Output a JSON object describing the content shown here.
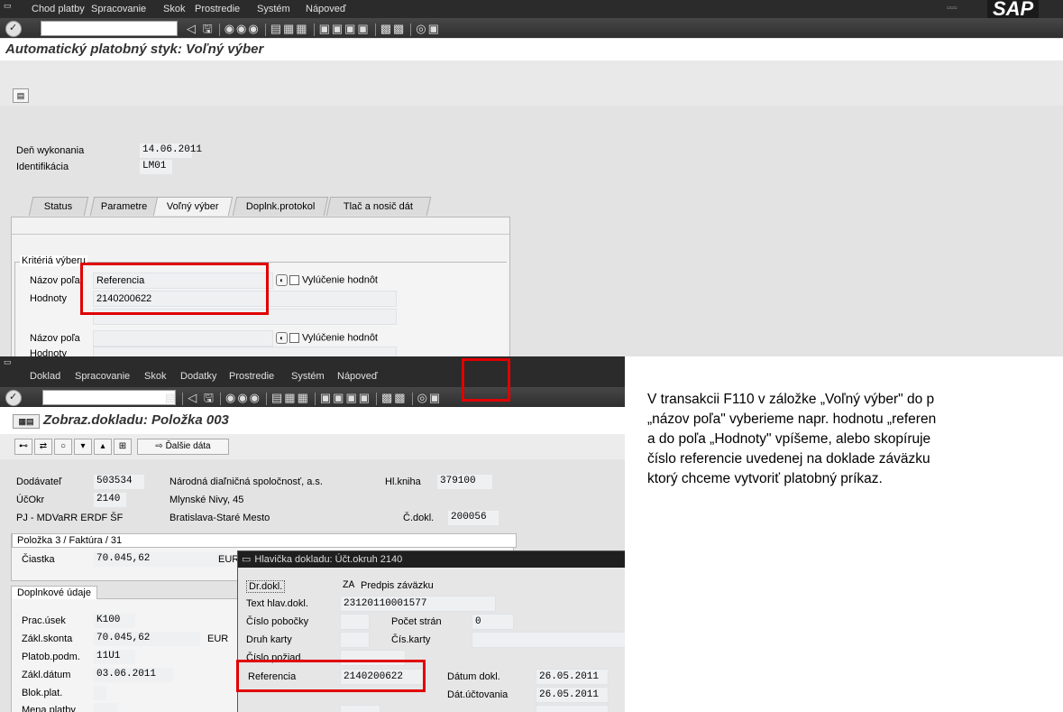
{
  "screen1": {
    "menu": [
      "Chod platby",
      "Spracovanie",
      "Skok",
      "Prostredie",
      "Systém",
      "Nápoveď"
    ],
    "logo": "SAP",
    "title": "Automatický platobný styk: Voľný výber",
    "fields": {
      "execution_day_label": "Deň wykonania",
      "execution_day_value": "14.06.2011",
      "identification_label": "Identifikácia",
      "identification_value": "LM01"
    },
    "tabs": [
      "Status",
      "Parametre",
      "Voľný výber",
      "Doplnk.protokol",
      "Tlač a nosič dát"
    ],
    "active_tab": "Voľný výber",
    "criteria": {
      "title": "Kritériá výberu",
      "field_name_label": "Názov poľa",
      "field_name_value": "Referencia",
      "values_label": "Hodnoty",
      "values_value": "2140200622",
      "exclude_label": "Vylúčenie hodnôt",
      "field_name_label2": "Názov poľa",
      "exclude_label2": "Vylúčenie hodnôt",
      "values_label2": "Hodnoty"
    }
  },
  "screen2": {
    "menu": [
      "Doklad",
      "Spracovanie",
      "Skok",
      "Dodatky",
      "Prostredie",
      "Systém",
      "Nápoveď"
    ],
    "title": "Zobraz.dokladu: Položka 003",
    "more_data_button": "Ďalšie dáta",
    "header": {
      "vendor_label": "Dodávateľ",
      "vendor_value": "503534",
      "vendor_name": "Národná diaľničná spoločnosť, a.s.",
      "ledger_label": "Hl.kniha",
      "ledger_value": "379100",
      "company_code_label": "ÚčOkr",
      "company_code_value": "2140",
      "street": "Mlynské Nivy, 45",
      "project": "PJ - MDVaRR ERDF ŠF",
      "city": "Bratislava-Staré Mesto",
      "doc_no_label": "Č.dokl.",
      "doc_no_value": "200056"
    },
    "item_group": "Položka 3 / Faktúra / 31",
    "amount_label": "Čiastka",
    "amount_value": "70.045,62",
    "currency": "EUR",
    "additional": {
      "title": "Doplnkové údaje",
      "work_unit_label": "Prac.úsek",
      "work_unit_value": "K100",
      "discount_base_label": "Zákl.skonta",
      "discount_base_value": "70.045,62",
      "currency": "EUR",
      "payment_terms_label": "Platob.podm.",
      "payment_terms_value": "11U1",
      "base_date_label": "Zákl.dátum",
      "base_date_value": "03.06.2011",
      "block_label": "Blok.plat.",
      "payment_currency_label": "Mena platby"
    }
  },
  "popup": {
    "title": "Hlavička dokladu: Účt.okruh 2140",
    "doc_type_label": "Dr.dokl.",
    "doc_type_value": "ZA",
    "doc_type_text": "Predpis záväzku",
    "header_text_label": "Text hlav.dokl.",
    "header_text_value": "23120110001577",
    "branch_label": "Číslo pobočky",
    "pages_label": "Počet strán",
    "pages_value": "0",
    "card_type_label": "Druh karty",
    "card_no_label": "Čís.karty",
    "request_no_label": "Číslo požiad.",
    "reference_label": "Referencia",
    "reference_value": "2140200622",
    "doc_date_label": "Dátum dokl.",
    "doc_date_value": "26.05.2011",
    "posting_date_label": "Dát.účtovania",
    "posting_date_value": "26.05.2011"
  },
  "explanation": [
    "V transakcii F110 v záložke „Voľný výber\" do p",
    "„názov poľa\" vyberieme napr. hodnotu „referen",
    "a do poľa  „Hodnoty\" vpíšeme, alebo skopíruje",
    "číslo referencie uvedenej na doklade záväzku",
    "ktorý chceme vytvoriť platobný príkaz."
  ],
  "colors": {
    "highlight": "#e00000",
    "menubar": "#2b2b2b",
    "background": "#e3e3e3"
  }
}
